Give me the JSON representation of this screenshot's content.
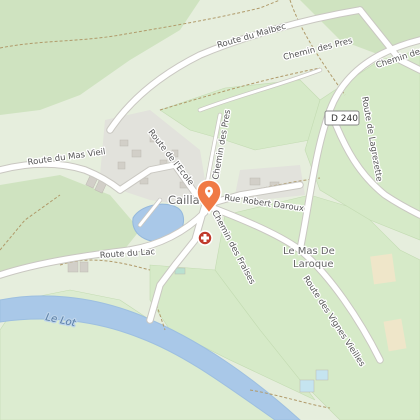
{
  "map": {
    "village": "Cailla",
    "place": "Le Mas De Laroque",
    "river": "Le Lot",
    "route_shield": "D 240",
    "roads": {
      "malbec": "Route du Malbec",
      "mas_vieil": "Route du Mas Vieil",
      "ecole": "Route de l'Ecole",
      "lac": "Route du Lac",
      "pres_north": "Chemin des Pres",
      "pres_vertical": "Chemin des Pres",
      "pres_east": "Chemin des Pres",
      "daroux": "Rue Robert Daroux",
      "fraises": "Chemin des Fraises",
      "vignes": "Route des Vignes Vieilles",
      "lagrezette": "Route de Lagrezette"
    }
  },
  "markers": {
    "selected": {
      "icon": "map-pin-icon",
      "color": "#f07a45"
    },
    "pharmacy": {
      "icon": "pharmacy-cross-icon",
      "color": "#c0392b"
    }
  }
}
